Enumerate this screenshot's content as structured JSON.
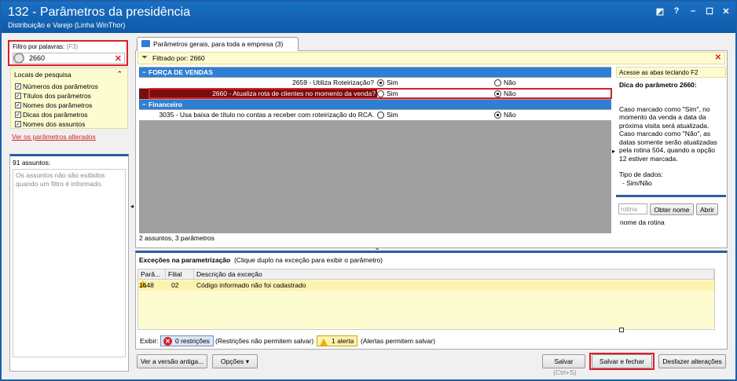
{
  "window": {
    "title": "132 - Parâmetros da presidência",
    "subtitle": "Distribuição e Varejo (Linha WinThor)",
    "controls": [
      "restore-icon",
      "help-icon",
      "minimize-icon",
      "maximize-icon",
      "close-icon"
    ]
  },
  "filter": {
    "label": "Filtro por palavras:",
    "shortcut": "(F3)",
    "value": "2660"
  },
  "search_locations": {
    "title": "Locais de pesquisa",
    "options": [
      {
        "label": "Números dos parâmetros",
        "checked": true
      },
      {
        "label": "Títulos dos parâmetros",
        "checked": true
      },
      {
        "label": "Nomes dos parâmetros",
        "checked": true
      },
      {
        "label": "Dicas dos parâmetros",
        "checked": true
      },
      {
        "label": "Nomes dos assuntos",
        "checked": true
      }
    ]
  },
  "altered_link": "Ver os parâmetros alterados",
  "subjects": {
    "count_label": "91 assuntos:",
    "message": "Os assuntos não são exibidos quando um filtro é informado."
  },
  "tab": {
    "label": "Parâmetros gerais, para toda a empresa  (3)"
  },
  "filtered_by": "Filtrado por: 2660",
  "groups": [
    {
      "title": "FORÇA DE VENDAS",
      "rows": [
        {
          "name": "2659 - Utiliza Roteirização?",
          "opt1": "Sim",
          "opt2": "Não",
          "selected_option": "Sim",
          "highlighted": false
        },
        {
          "name": "2660 - Atualiza rota de clientes no momento da venda?",
          "opt1": "Sim",
          "opt2": "Não",
          "selected_option": "Não",
          "highlighted": true
        }
      ]
    },
    {
      "title": "Financeiro",
      "rows": [
        {
          "name": "3035 - Usa baixa de título no contas a receber com roteirização do RCA.",
          "opt1": "Sim",
          "opt2": "Não",
          "selected_option": "Não",
          "highlighted": false
        }
      ]
    }
  ],
  "grid_footer": "2 assuntos, 3 parâmetros",
  "hint_bar": "Acesse as abas teclando F2",
  "tip": {
    "title": "Dica do parâmetro 2660:",
    "body": "Caso marcado como \"Sim\", no momento da venda a data da próxima visita será atualizada. Caso marcado como \"Não\", as datas somente serão atualizadas pela rotina 504, quando a opção 12 estiver marcada.",
    "data_type_label": "Tipo de dados:",
    "data_type_value": "- Sim/Não"
  },
  "routine": {
    "placeholder": "rotina",
    "btn_name": "Obter nome",
    "btn_open": "Abrir",
    "caption": "nome da rotina"
  },
  "exceptions": {
    "title": "Exceções na parametrização",
    "hint": "(Clique duplo na exceção para exibir o parâmetro)",
    "columns": [
      "Parâ...",
      "Filial",
      "Descrição da exceção"
    ],
    "rows": [
      {
        "param": "1648",
        "branch": "02",
        "description": "Código informado não foi cadastrado"
      }
    ],
    "show_label": "Exibir:",
    "restrictions_btn": "0 restrições",
    "restrictions_note": "(Restrições não permitem salvar)",
    "alerts_btn": "1 alerta",
    "alerts_note": "(Alertas permitem salvar)"
  },
  "footer": {
    "old_version": "Ver a versão antiga...",
    "options": "Opções",
    "save": "Salvar",
    "save_shortcut": "(Ctrl+S)",
    "save_close": "Salvar e fechar",
    "undo": "Desfazer alterações"
  }
}
